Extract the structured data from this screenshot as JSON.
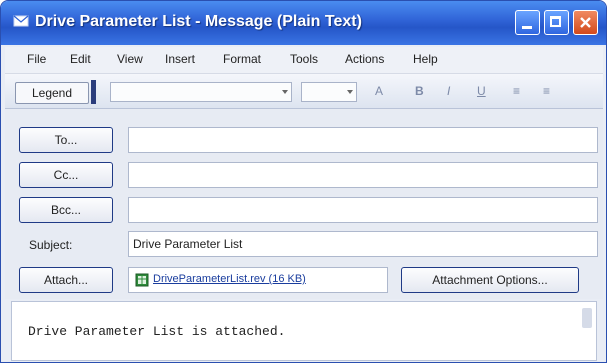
{
  "window": {
    "title": "Drive Parameter List - Message (Plain Text)"
  },
  "menu": {
    "items": [
      "File",
      "Edit",
      "View",
      "Insert",
      "Format",
      "Tools",
      "Actions",
      "Help"
    ]
  },
  "toolbar": {
    "legend_label": "Legend",
    "format_buttons": [
      "A",
      "B",
      "I",
      "U",
      "≡",
      "≡"
    ]
  },
  "header": {
    "to_label": "To...",
    "to_value": "",
    "cc_label": "Cc...",
    "cc_value": "",
    "bcc_label": "Bcc...",
    "bcc_value": "",
    "subject_label": "Subject:",
    "subject_value": "Drive Parameter List",
    "attach_label": "Attach...",
    "attachment_name": "DriveParameterList.rev (16 KB)",
    "attachment_options_label": "Attachment Options..."
  },
  "message": {
    "body": "Drive Parameter List is attached."
  }
}
